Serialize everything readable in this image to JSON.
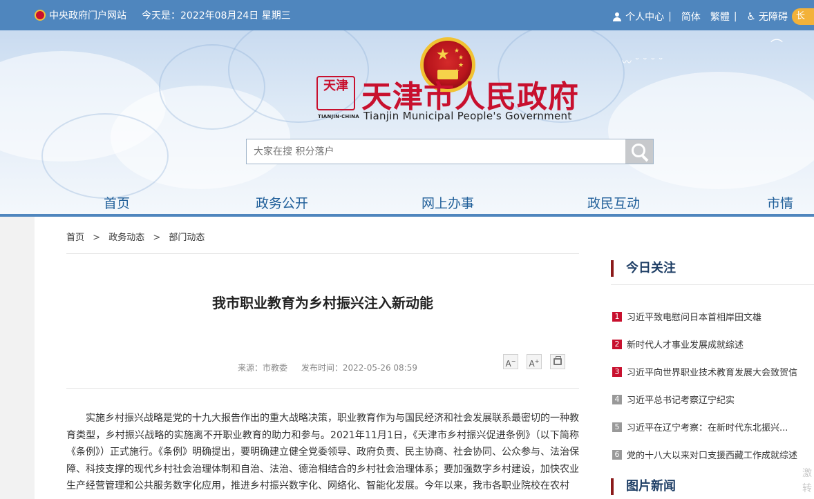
{
  "topbar": {
    "portal": "中央政府门户网站",
    "date": "今天是：2022年08月24日 星期三",
    "user_center": "个人中心",
    "simplified": "简体",
    "traditional": "繁體",
    "accessibility": "无障碍",
    "pill_text": "长"
  },
  "header": {
    "stamp_text": "天津",
    "stamp_sub": "TIANJIN·CHINA",
    "title": "天津市人民政府",
    "subtitle": "Tianjin Municipal People's Government"
  },
  "search": {
    "placeholder": "大家在搜 积分落户"
  },
  "nav": {
    "items": [
      "首页",
      "政务公开",
      "网上办事",
      "政民互动",
      "市情"
    ]
  },
  "breadcrumb": {
    "items": [
      "首页",
      "政务动态",
      "部门动态"
    ],
    "separator": ">"
  },
  "article": {
    "title": "我市职业教育为乡村振兴注入新动能",
    "source": "来源：市教委",
    "publish_time": "发布时间：2022-05-26 08:59",
    "font_decrease": "A",
    "font_increase": "A",
    "body": "实施乡村振兴战略是党的十九大报告作出的重大战略决策，职业教育作为与国民经济和社会发展联系最密切的一种教育类型，乡村振兴战略的实施离不开职业教育的助力和参与。2021年11月1日，《天津市乡村振兴促进条例》（以下简称《条例》）正式施行。《条例》明确提出，要明确建立健全党委领导、政府负责、民主协商、社会协同、公众参与、法治保障、科技支撑的现代乡村社会治理体制和自治、法治、德治相结合的乡村社会治理体系；要加强数字乡村建设，加快农业生产经营管理和公共服务数字化应用，推进乡村振兴数字化、网络化、智能化发展。今年以来，我市各职业院校在农村"
  },
  "sidebar": {
    "today_title": "今日关注",
    "news": [
      {
        "num": "1",
        "text": "习近平致电慰问日本首相岸田文雄"
      },
      {
        "num": "2",
        "text": "新时代人才事业发展成就综述"
      },
      {
        "num": "3",
        "text": "习近平向世界职业技术教育发展大会致贺信"
      },
      {
        "num": "4",
        "text": "习近平总书记考察辽宁纪实"
      },
      {
        "num": "5",
        "text": "习近平在辽宁考察：在新时代东北振兴..."
      },
      {
        "num": "6",
        "text": "党的十八大以来对口支援西藏工作成就综述"
      }
    ],
    "photo_title": "图片新闻",
    "watermark": [
      "激",
      "转"
    ]
  }
}
